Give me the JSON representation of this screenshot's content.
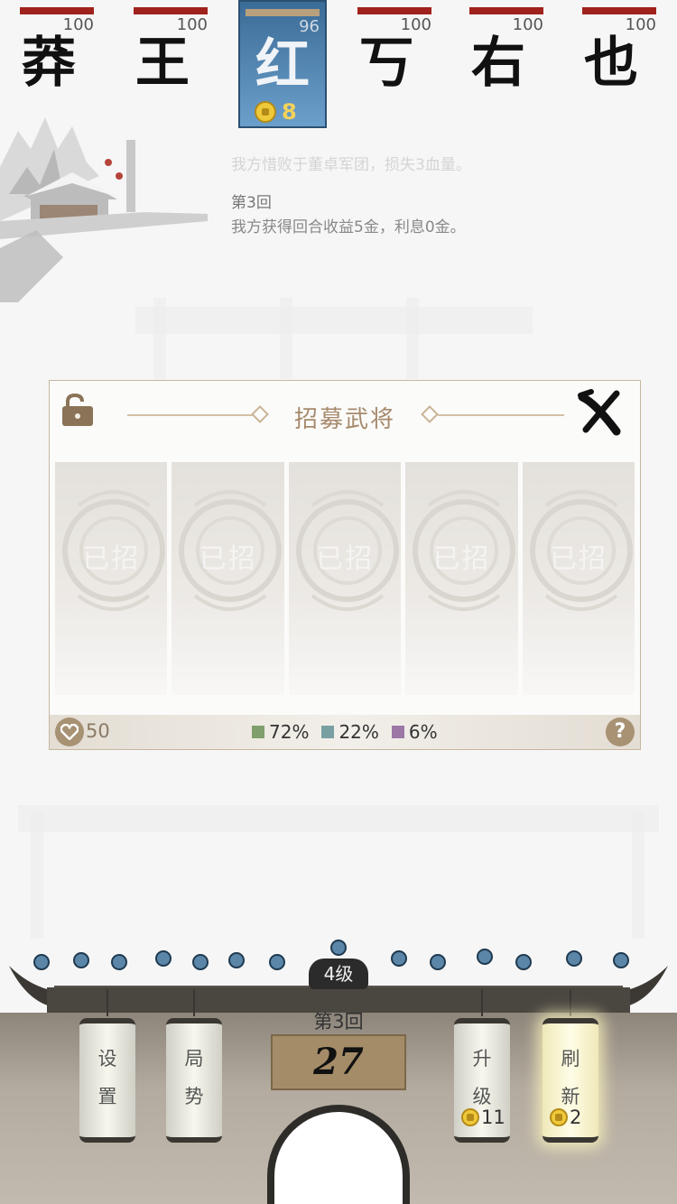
{
  "players": [
    {
      "name": "莽",
      "hp": "100",
      "active": false
    },
    {
      "name": "王",
      "hp": "100",
      "active": false
    },
    {
      "name": "红",
      "hp": "96",
      "active": true,
      "gold": "8"
    },
    {
      "name": "丂",
      "hp": "100",
      "active": false
    },
    {
      "name": "右",
      "hp": "100",
      "active": false
    },
    {
      "name": "也",
      "hp": "100",
      "active": false
    }
  ],
  "log": {
    "faded_line": "我方惜败于董卓军团，损失3血量。",
    "round": "第3回",
    "line": "我方获得回合收益5金，利息0金。"
  },
  "dialog": {
    "title": "招募武将",
    "lock_icon": "unlock-icon",
    "close_icon": "close-icon",
    "cards": [
      "已招",
      "已招",
      "已招",
      "已招",
      "已招"
    ],
    "heart_value": "50",
    "rates": [
      {
        "value": "72%",
        "color": "#7f9f6c"
      },
      {
        "value": "22%",
        "color": "#78a0a3"
      },
      {
        "value": "6%",
        "color": "#9b78a6"
      }
    ],
    "help": "?"
  },
  "bottom": {
    "level": "4级",
    "round": "第3回",
    "timer": "27",
    "settings": [
      "设",
      "置"
    ],
    "situation": [
      "局",
      "势"
    ],
    "upgrade": {
      "label": [
        "升",
        "级"
      ],
      "cost": "11"
    },
    "refresh": {
      "label": [
        "刷",
        "新"
      ],
      "cost": "2"
    }
  },
  "colors": {
    "hp": "#a0221c",
    "active": "#4c7fae",
    "accent": "#a68a6c"
  }
}
